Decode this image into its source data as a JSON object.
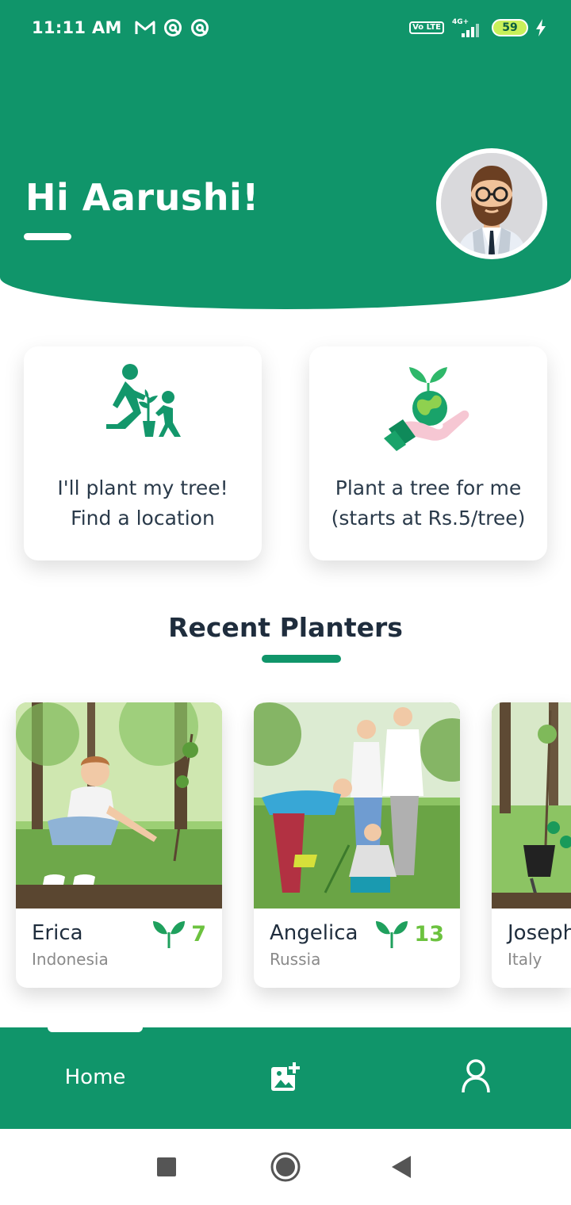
{
  "status_bar": {
    "time": "11:11 AM",
    "battery": "59",
    "network": "4G+",
    "volte": "Vo LTE",
    "icons": [
      "gmail-icon",
      "sync-icon",
      "sync-icon",
      "volte-icon",
      "signal-icon",
      "battery-icon",
      "charging-icon"
    ]
  },
  "header": {
    "greeting": "Hi Aarushi!",
    "avatar_icon": "avatar-man-beard-glasses"
  },
  "actions": [
    {
      "label": "I'll plant my tree!\nFind a location",
      "icon": "people-planting-icon"
    },
    {
      "label": "Plant a tree for me\n(starts at Rs.5/tree)",
      "icon": "hand-globe-sprout-icon"
    }
  ],
  "recent": {
    "title": "Recent Planters",
    "planters": [
      {
        "name": "Erica",
        "country": "Indonesia",
        "count": "7"
      },
      {
        "name": "Angelica",
        "country": "Russia",
        "count": "13"
      },
      {
        "name": "Joseph",
        "country": "Italy",
        "count": ""
      }
    ]
  },
  "nav": {
    "home": "Home",
    "items": [
      "home-tab",
      "add-photo-icon",
      "profile-icon"
    ]
  },
  "colors": {
    "primary": "#10956a",
    "accent_green": "#6cc23f",
    "text_dark": "#1f2d3d",
    "text_muted": "#8a8a8a"
  }
}
